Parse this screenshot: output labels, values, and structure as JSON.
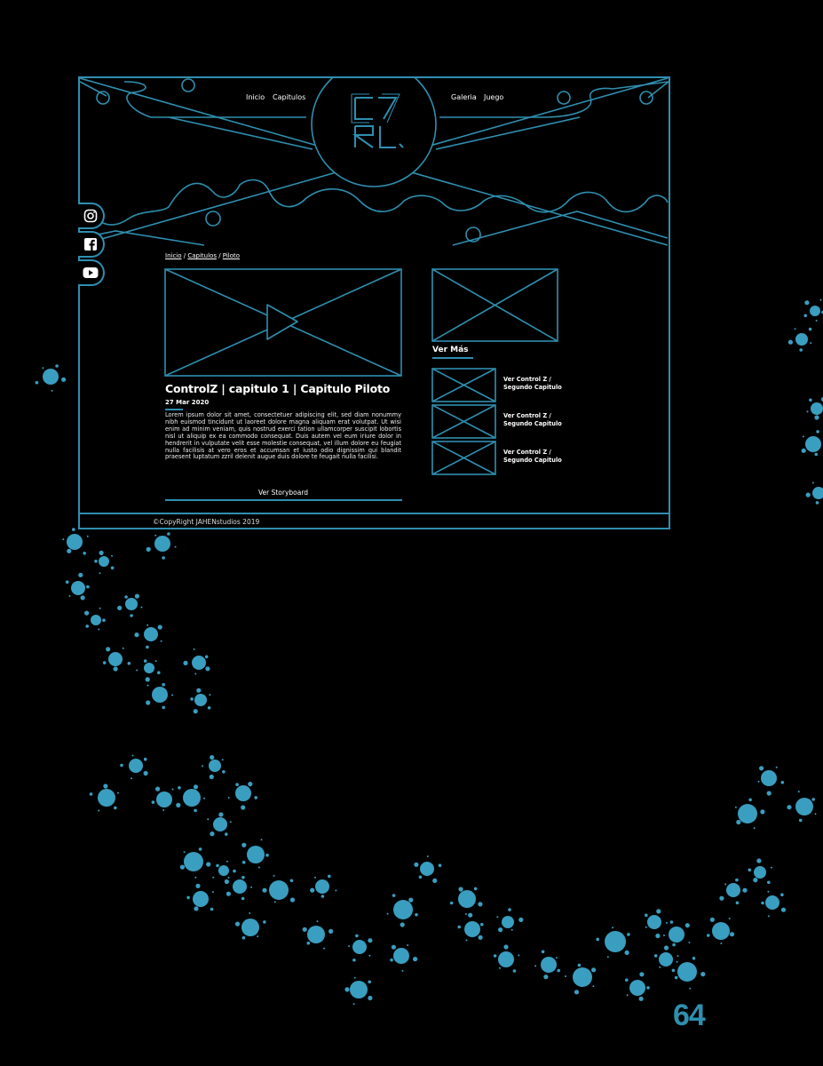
{
  "nav": {
    "left": [
      "Inicio",
      "Capitulos"
    ],
    "right": [
      "Galeria",
      "Juego"
    ],
    "logo_text": "C7 RL."
  },
  "social": [
    "instagram-icon",
    "facebook-icon",
    "youtube-icon"
  ],
  "breadcrumb": {
    "items": [
      "Inicio",
      "Capitulos",
      "Piloto"
    ],
    "separator": " / "
  },
  "article": {
    "title": "ControlZ | capitulo 1 | Capitulo Piloto",
    "date": "27 Mar 2020",
    "body": "Lorem ipsum dolor sit amet, consectetuer adipiscing elit, sed diam nonummy nibh euismod tincidunt ut laoreet dolore magna aliquam erat volutpat. Ut wisi enim ad minim veniam, quis nostrud exerci tation ullamcorper suscipit lobortis nisl ut aliquip ex ea commodo consequat. Duis autem vel eum iriure dolor in hendrerit in vulputate velit esse molestie consequat, vel illum dolore eu feugiat nulla facilisis at vero eros et accumsan et iusto odio dignissim qui blandit praesent luptatum zzril delenit augue duis dolore te feugait nulla facilisi.",
    "storyboard_label": "Ver Storyboard"
  },
  "sidebar": {
    "heading": "Ver Más",
    "related": [
      {
        "line1": "Ver Control Z /",
        "line2": "Segundo Capitulo"
      },
      {
        "line1": "Ver Control Z /",
        "line2": "Segundo Capitulo"
      },
      {
        "line1": "Ver Control Z /",
        "line2": "Segundo Capitulo"
      }
    ]
  },
  "footer": {
    "copyright": "©CopyRight JAHENstudios 2019"
  },
  "page_number": "64",
  "colors": {
    "accent": "#2f8fb0",
    "splatter": "#3a9ec0",
    "background": "#000000"
  }
}
